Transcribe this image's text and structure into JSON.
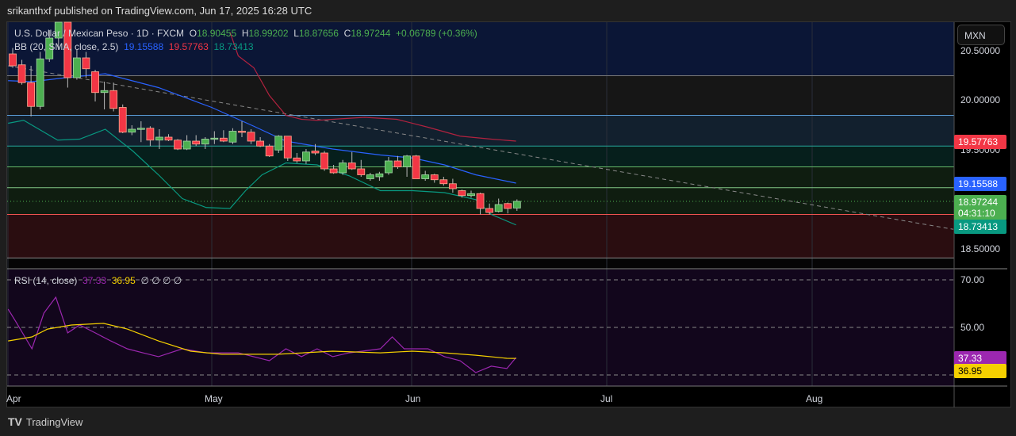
{
  "header": {
    "published": "srikanthxf published on TradingView.com, Jun 17, 2025 16:28 UTC"
  },
  "legend": {
    "symbol": "U.S. Dollar / Mexican Peso · 1D · FXCM",
    "o_label": "O",
    "o": "18.90455",
    "h_label": "H",
    "h": "18.99202",
    "l_label": "L",
    "l": "18.87656",
    "c_label": "C",
    "c": "18.97244",
    "change": "+0.06789 (+0.36%)",
    "bb_label": "BB (20, SMA, close, 2.5)",
    "bb_mid": "19.15588",
    "bb_up": "19.57763",
    "bb_low": "18.73413",
    "rsi_label": "RSI (14, close)",
    "rsi": "37.33",
    "rsi_ma": "36.95",
    "rsi_extra": "∅ ∅ ∅ ∅"
  },
  "currency": "MXN",
  "price_scale": {
    "ticks": [
      "20.50000",
      "20.00000",
      "19.50000",
      "18.50000"
    ],
    "upper_tag": "19.57763",
    "mid_tag": "19.15588",
    "close_tag": "18.97244",
    "countdown": "04:31:10",
    "lower_tag": "18.73413"
  },
  "rsi_scale": {
    "ticks": [
      "70.00",
      "50.00"
    ],
    "rsi_tag": "37.33",
    "ma_tag": "36.95"
  },
  "time_axis": [
    "Apr",
    "May",
    "Jun",
    "Jul",
    "Aug"
  ],
  "branding": "TradingView",
  "colors": {
    "up": "#4caf50",
    "down": "#f23645",
    "bb_mid": "#2962ff",
    "bb_up": "#b2223f",
    "bb_low": "#089981",
    "rsi": "#9c27b0",
    "rsi_ma": "#f5d000"
  },
  "chart_data": {
    "type": "candlestick",
    "title": "USD/MXN 1D FXCM",
    "ylim": [
      18.34,
      20.78
    ],
    "rsi_ylim": [
      25,
      75
    ],
    "candles": [
      [
        20.46,
        20.52,
        20.32,
        20.34
      ],
      [
        20.35,
        20.4,
        20.15,
        20.17
      ],
      [
        20.17,
        20.34,
        19.83,
        19.93
      ],
      [
        19.93,
        20.48,
        19.9,
        20.41
      ],
      [
        20.41,
        20.7,
        20.38,
        20.62
      ],
      [
        20.62,
        20.95,
        20.5,
        20.9
      ],
      [
        20.9,
        20.95,
        20.12,
        20.22
      ],
      [
        20.22,
        20.5,
        20.2,
        20.42
      ],
      [
        20.42,
        20.48,
        20.22,
        20.31
      ],
      [
        20.28,
        20.3,
        19.98,
        20.07
      ],
      [
        20.07,
        20.18,
        19.9,
        20.09
      ],
      [
        20.09,
        20.17,
        19.88,
        19.91
      ],
      [
        19.92,
        19.95,
        19.66,
        19.67
      ],
      [
        19.67,
        19.74,
        19.64,
        19.7
      ],
      [
        19.71,
        19.78,
        19.57,
        19.71
      ],
      [
        19.71,
        19.73,
        19.53,
        19.59
      ],
      [
        19.59,
        19.7,
        19.5,
        19.62
      ],
      [
        19.62,
        19.65,
        19.58,
        19.59
      ],
      [
        19.59,
        19.6,
        19.49,
        19.5
      ],
      [
        19.5,
        19.64,
        19.49,
        19.58
      ],
      [
        19.58,
        19.64,
        19.53,
        19.55
      ],
      [
        19.55,
        19.62,
        19.5,
        19.6
      ],
      [
        19.6,
        19.68,
        19.55,
        19.61
      ],
      [
        19.61,
        19.69,
        19.57,
        19.58
      ],
      [
        19.57,
        19.71,
        19.55,
        19.68
      ],
      [
        19.68,
        19.78,
        19.62,
        19.67
      ],
      [
        19.67,
        19.7,
        19.55,
        19.58
      ],
      [
        19.58,
        19.62,
        19.52,
        19.53
      ],
      [
        19.53,
        19.55,
        19.42,
        19.43
      ],
      [
        19.49,
        19.64,
        19.46,
        19.63
      ],
      [
        19.63,
        19.63,
        19.38,
        19.41
      ],
      [
        19.41,
        19.46,
        19.36,
        19.38
      ],
      [
        19.38,
        19.5,
        19.35,
        19.47
      ],
      [
        19.48,
        19.55,
        19.44,
        19.46
      ],
      [
        19.46,
        19.48,
        19.28,
        19.3
      ],
      [
        19.3,
        19.34,
        19.25,
        19.26
      ],
      [
        19.26,
        19.39,
        19.24,
        19.36
      ],
      [
        19.36,
        19.47,
        19.29,
        19.3
      ],
      [
        19.3,
        19.39,
        19.22,
        19.24
      ],
      [
        19.2,
        19.26,
        19.18,
        19.24
      ],
      [
        19.22,
        19.27,
        19.18,
        19.25
      ],
      [
        19.26,
        19.42,
        19.24,
        19.38
      ],
      [
        19.38,
        19.43,
        19.3,
        19.32
      ],
      [
        19.32,
        19.44,
        19.22,
        19.43
      ],
      [
        19.43,
        19.44,
        19.2,
        19.2
      ],
      [
        19.2,
        19.28,
        19.18,
        19.24
      ],
      [
        19.24,
        19.25,
        19.16,
        19.19
      ],
      [
        19.19,
        19.22,
        19.13,
        19.15
      ],
      [
        19.15,
        19.2,
        19.06,
        19.1
      ],
      [
        19.08,
        19.09,
        19.01,
        19.03
      ],
      [
        19.03,
        19.08,
        19.01,
        19.05
      ],
      [
        19.05,
        19.06,
        18.84,
        18.9
      ],
      [
        18.9,
        18.95,
        18.84,
        18.86
      ],
      [
        18.87,
        19.0,
        18.86,
        18.94
      ],
      [
        18.95,
        18.96,
        18.85,
        18.9
      ],
      [
        18.90455,
        18.99202,
        18.87656,
        18.97244
      ]
    ],
    "bb_upper": [
      [
        23.7,
        20.68
      ],
      [
        24.6,
        20.44
      ],
      [
        26.3,
        20.32
      ],
      [
        28,
        20.04
      ],
      [
        29.8,
        19.84
      ],
      [
        31.5,
        19.8
      ],
      [
        33.2,
        19.79
      ],
      [
        34.9,
        19.8
      ],
      [
        38.4,
        19.82
      ],
      [
        41.9,
        19.8
      ],
      [
        45.3,
        19.72
      ],
      [
        48.8,
        19.63
      ],
      [
        52.2,
        19.6
      ],
      [
        54.9,
        19.58
      ]
    ],
    "bb_middle": [
      [
        -0.5,
        20.19
      ],
      [
        2.1,
        20.18
      ],
      [
        5.8,
        20.22
      ],
      [
        10.1,
        20.26
      ],
      [
        15.9,
        20.12
      ],
      [
        21.7,
        19.92
      ],
      [
        24.6,
        19.8
      ],
      [
        26.3,
        19.73
      ],
      [
        29.8,
        19.58
      ],
      [
        34.9,
        19.5
      ],
      [
        40.1,
        19.44
      ],
      [
        43.6,
        19.41
      ],
      [
        47.1,
        19.34
      ],
      [
        50.5,
        19.24
      ],
      [
        54.9,
        19.156
      ]
    ],
    "bb_lower": [
      [
        -0.5,
        19.76
      ],
      [
        1.2,
        19.79
      ],
      [
        4.9,
        19.59
      ],
      [
        7.3,
        19.6
      ],
      [
        10.1,
        19.7
      ],
      [
        13.1,
        19.48
      ],
      [
        15.9,
        19.24
      ],
      [
        18.5,
        19.0
      ],
      [
        21.1,
        18.91
      ],
      [
        23.7,
        18.9
      ],
      [
        25.4,
        19.08
      ],
      [
        27.2,
        19.24
      ],
      [
        29.8,
        19.36
      ],
      [
        33.2,
        19.34
      ],
      [
        36.7,
        19.23
      ],
      [
        40.1,
        19.08
      ],
      [
        43.6,
        19.08
      ],
      [
        47.1,
        19.06
      ],
      [
        50.5,
        18.99
      ],
      [
        52.2,
        18.84
      ],
      [
        54.9,
        18.734
      ]
    ],
    "rsi": [
      [
        -0.5,
        57.7
      ],
      [
        0.3,
        52.7
      ],
      [
        2.1,
        41
      ],
      [
        3.4,
        56
      ],
      [
        4.7,
        62.7
      ],
      [
        6,
        47.7
      ],
      [
        7.3,
        51
      ],
      [
        9,
        47.7
      ],
      [
        10.7,
        44.3
      ],
      [
        12.5,
        41
      ],
      [
        14.2,
        39.3
      ],
      [
        15.9,
        37.7
      ],
      [
        18.5,
        41
      ],
      [
        21.1,
        39.3
      ],
      [
        24.6,
        39.3
      ],
      [
        28,
        36
      ],
      [
        29.8,
        41
      ],
      [
        31.5,
        37.7
      ],
      [
        33.2,
        41
      ],
      [
        34.9,
        37.7
      ],
      [
        36.7,
        39.3
      ],
      [
        40.1,
        41
      ],
      [
        41.4,
        46
      ],
      [
        42.7,
        41
      ],
      [
        45.3,
        41
      ],
      [
        47.1,
        37.7
      ],
      [
        48.8,
        36
      ],
      [
        50.5,
        31
      ],
      [
        52.2,
        33.7
      ],
      [
        53.9,
        32.7
      ],
      [
        54.9,
        37.33
      ]
    ],
    "rsi_ma": [
      [
        -0.5,
        44.3
      ],
      [
        2.1,
        46
      ],
      [
        3.8,
        49.3
      ],
      [
        6.4,
        51
      ],
      [
        9.9,
        51.7
      ],
      [
        12.5,
        49.3
      ],
      [
        15.9,
        44.3
      ],
      [
        19.4,
        40
      ],
      [
        22.8,
        38.7
      ],
      [
        28.9,
        38.7
      ],
      [
        34.9,
        40
      ],
      [
        40.1,
        39.3
      ],
      [
        43.6,
        40
      ],
      [
        47.1,
        39.3
      ],
      [
        50.5,
        38.3
      ],
      [
        53.9,
        37
      ],
      [
        54.9,
        36.95
      ]
    ],
    "trendline": [
      [
        -0.5,
        20.34
      ],
      [
        102.6,
        18.69
      ]
    ],
    "levels": [
      20.24,
      19.84,
      19.53,
      19.32,
      19.11,
      18.84,
      18.4
    ],
    "rsi_levels": [
      70,
      50,
      30
    ]
  }
}
